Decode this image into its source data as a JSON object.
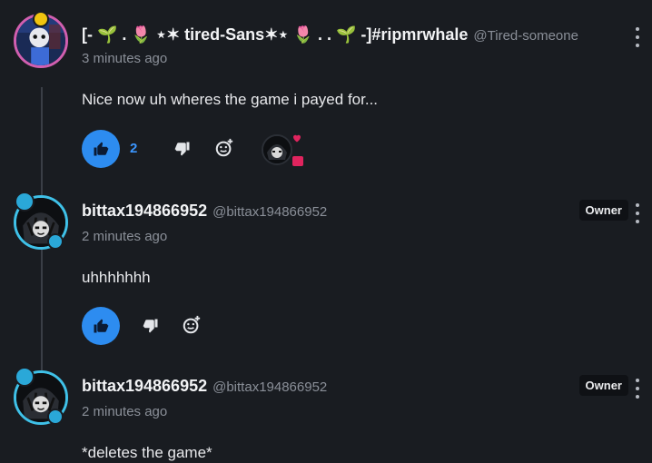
{
  "comments": [
    {
      "username": "[- 🌱 . 🌷 ⋆✶ tired-Sans✶⋆ 🌷 . . 🌱 -]#ripmrwhale",
      "handle": "@Tired-someone",
      "time": "3 minutes ago",
      "body": "Nice now uh wheres the game i payed for...",
      "likes": "2",
      "avatar_border_color": "#d15fb0"
    },
    {
      "username": "bittax194866952",
      "handle": "@bittax194866952",
      "time": "2 minutes ago",
      "body": "uhhhhhhh",
      "badge": "Owner",
      "avatar_border_color": "#3fc1e8"
    },
    {
      "username": "bittax194866952",
      "handle": "@bittax194866952",
      "time": "2 minutes ago",
      "body": "*deletes the game*",
      "badge": "Owner",
      "avatar_border_color": "#3fc1e8"
    }
  ],
  "icons": {
    "like": "thumbs-up-icon",
    "dislike": "thumbs-down-icon",
    "react": "add-reaction-icon",
    "more": "kebab-menu-icon",
    "heart": "heart-icon",
    "chat": "chat-bubble-icon"
  },
  "colors": {
    "background": "#191c21",
    "like_button": "#2d8cf0",
    "like_count": "#3b96ff",
    "muted_text": "#8a8f98",
    "owner_badge_bg": "#0f1115",
    "heart": "#e0245e"
  }
}
